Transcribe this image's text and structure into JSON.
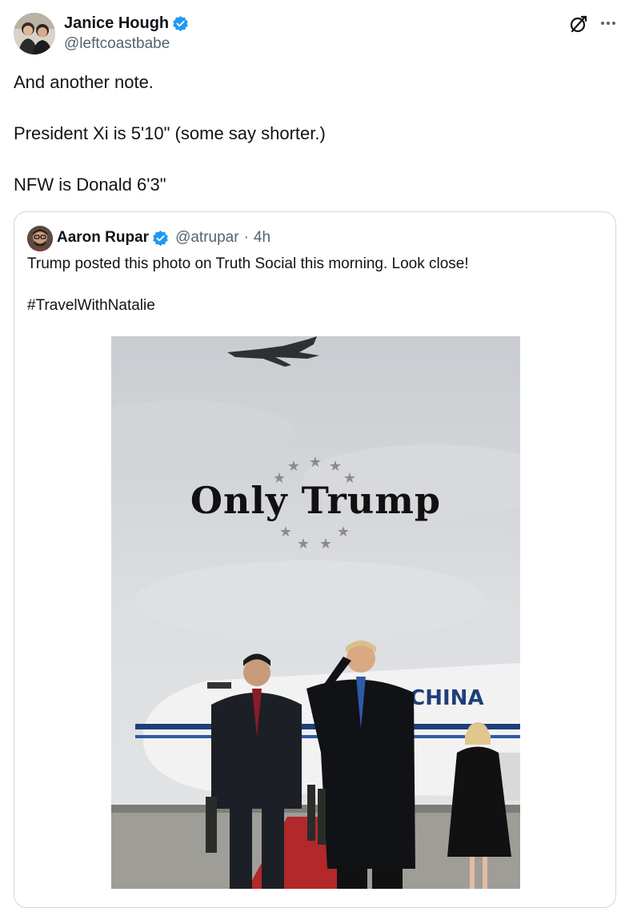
{
  "post": {
    "author_name": "Janice Hough",
    "author_handle": "@leftcoastbabe",
    "lines": [
      "And another note.",
      "President Xi is 5'10\" (some say shorter.)",
      "NFW is Donald 6'3\""
    ]
  },
  "quote": {
    "author_name": "Aaron Rupar",
    "author_handle": "@atrupar",
    "separator": "·",
    "time": "4h",
    "text": "Trump posted this photo on Truth Social this morning. Look close!",
    "hashtag": "#TravelWithNatalie",
    "image": {
      "logo_text": "Only Trump",
      "plane_text": "IR CHINA"
    }
  },
  "icons": {
    "verified": "verified-badge-icon",
    "grok": "grok-icon",
    "more": "more-icon"
  },
  "colors": {
    "verified": "#1d9bf0",
    "text": "#0f1419",
    "secondary": "#536471",
    "border": "#cfd9de"
  }
}
